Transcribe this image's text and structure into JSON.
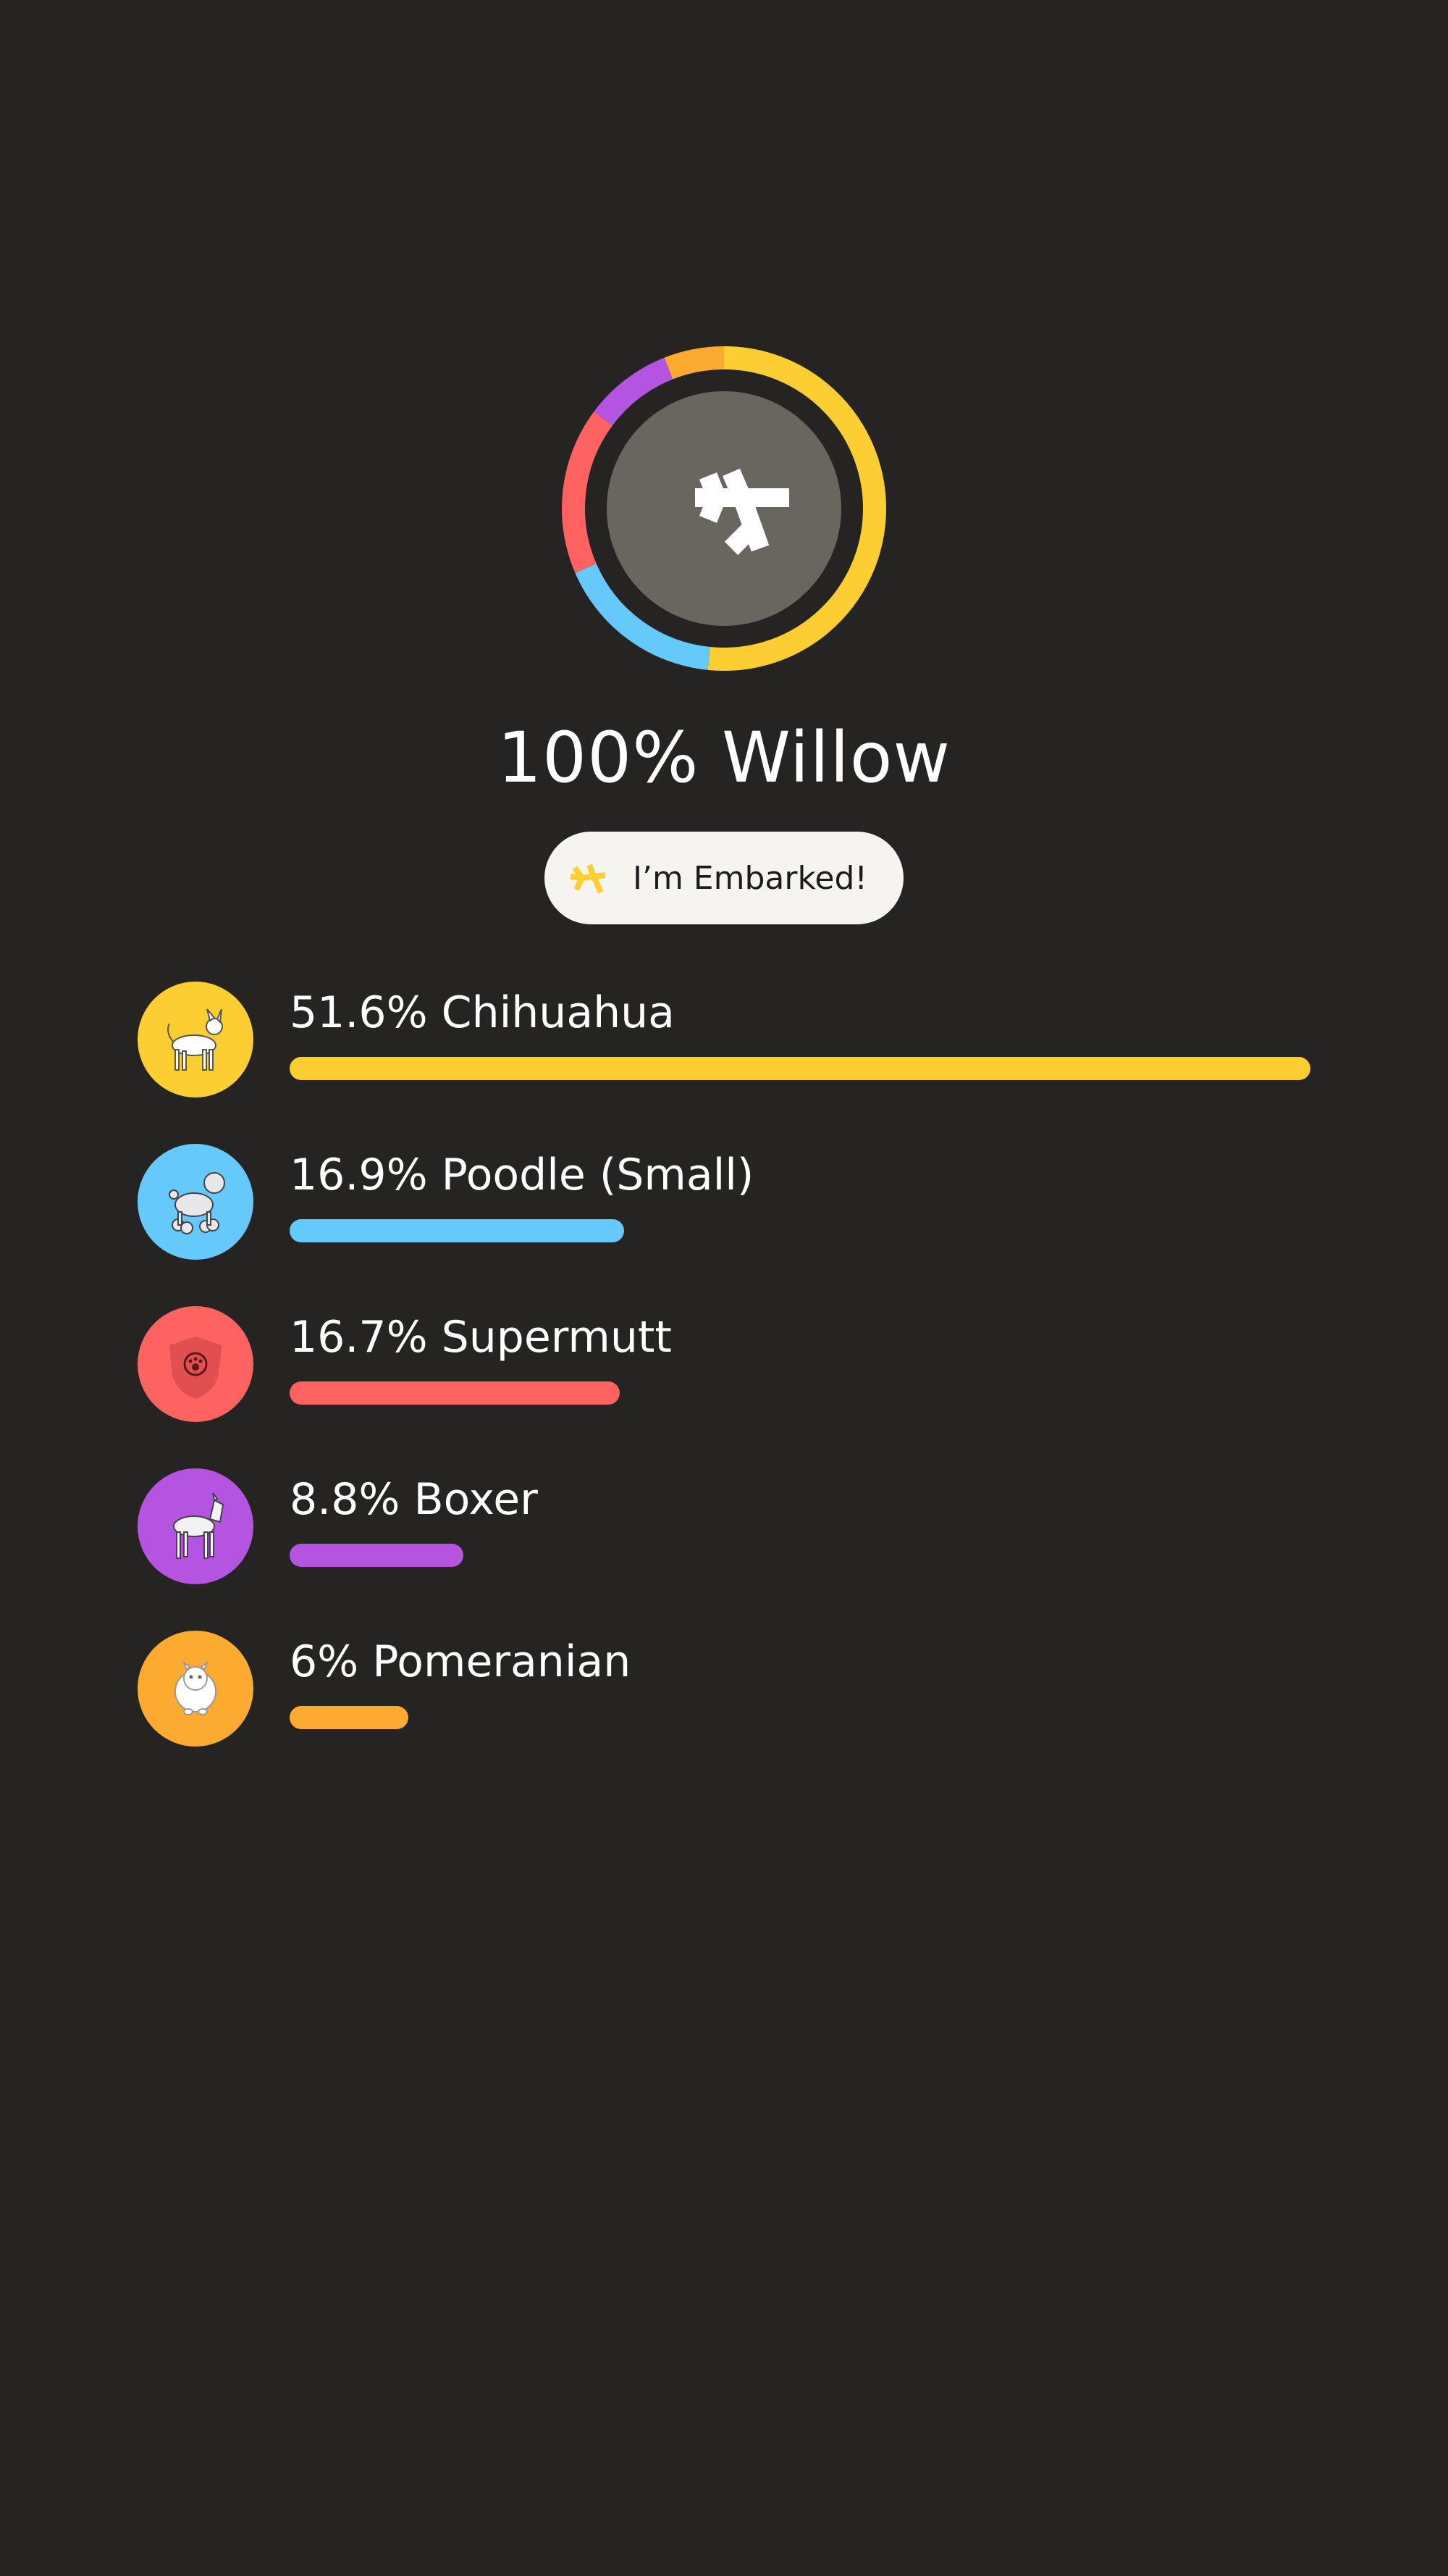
{
  "profile": {
    "name": "100% Willow",
    "badge_label": "I’m Embarked!"
  },
  "colors": {
    "background": "#252423",
    "ring_center": "#696660",
    "badge_background": "#f6f4f0",
    "badge_icon": "#fdce31"
  },
  "icons": {
    "center": "embark-logo-icon",
    "badge": "embark-logo-icon"
  },
  "breeds": [
    {
      "label": "51.6% Chihuahua",
      "percent": 51.6,
      "color": "#fdce31",
      "icon": "chihuahua-icon"
    },
    {
      "label": "16.9% Poodle (Small)",
      "percent": 16.9,
      "color": "#66c9fb",
      "icon": "poodle-icon"
    },
    {
      "label": "16.7% Supermutt",
      "percent": 16.7,
      "color": "#fe6261",
      "icon": "supermutt-shield-icon"
    },
    {
      "label": "8.8% Boxer",
      "percent": 8.8,
      "color": "#b554e1",
      "icon": "boxer-icon"
    },
    {
      "label": "6% Pomeranian",
      "percent": 6,
      "color": "#fdaa30",
      "icon": "pomeranian-icon"
    }
  ]
}
